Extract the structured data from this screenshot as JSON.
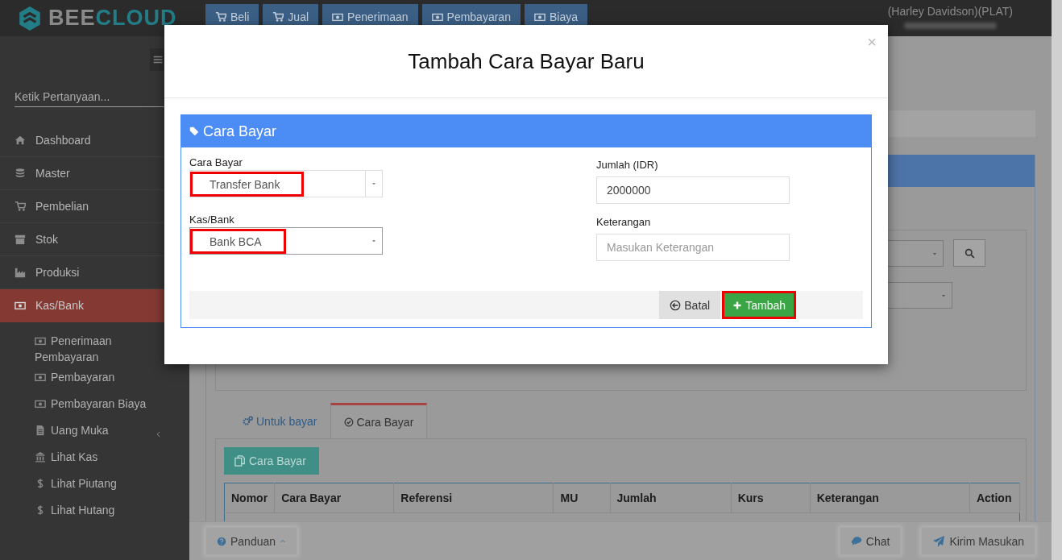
{
  "brand": {
    "part_1": "BEE",
    "part_2": "CLOUD"
  },
  "top_nav": [
    {
      "label": "Beli"
    },
    {
      "label": "Jual"
    },
    {
      "label": "Penerimaan"
    },
    {
      "label": "Pembayaran"
    },
    {
      "label": "Biaya"
    }
  ],
  "user": {
    "name": "(Harley Davidson)(PLAT)"
  },
  "sidebar": {
    "search": {
      "placeholder": "Ketik Pertanyaan..."
    },
    "items": [
      {
        "label": "Dashboard",
        "selected": false
      },
      {
        "label": "Master",
        "selected": false
      },
      {
        "label": "Pembelian",
        "selected": false
      },
      {
        "label": "Stok",
        "selected": false
      },
      {
        "label": "Produksi",
        "selected": false
      },
      {
        "label": "Kas/Bank",
        "selected": true,
        "children": [
          {
            "label": "Penerimaan Pembayaran",
            "has_submenu": false
          },
          {
            "label": "Pembayaran",
            "has_submenu": false
          },
          {
            "label": "Pembayaran Biaya",
            "has_submenu": false
          },
          {
            "label": "Uang Muka",
            "has_submenu": true
          },
          {
            "label": "Lihat Kas",
            "has_submenu": false
          },
          {
            "label": "Lihat Piutang",
            "has_submenu": false
          },
          {
            "label": "Lihat Hutang",
            "has_submenu": false
          }
        ]
      }
    ]
  },
  "main": {
    "tabs": [
      {
        "label": "Untuk bayar",
        "selected": false
      },
      {
        "label": "Cara Bayar",
        "selected": true
      }
    ],
    "add_button": "Cara Bayar",
    "table": {
      "columns": [
        "Nomor",
        "Cara Bayar",
        "Referensi",
        "MU",
        "Jumlah",
        "Kurs",
        "Keterangan",
        "Action"
      ]
    }
  },
  "modal": {
    "title": "Tambah Cara Bayar Baru",
    "close": "×",
    "panel_title": "Cara Bayar",
    "fields": [
      {
        "kind": "select",
        "label": "Cara Bayar",
        "value": "Transfer Bank",
        "highlighted": true
      },
      {
        "kind": "select",
        "label": "Kas/Bank",
        "value": "Bank BCA",
        "highlighted": true
      },
      {
        "kind": "text",
        "label": "Jumlah (IDR)",
        "value": "2000000",
        "highlighted": false
      },
      {
        "kind": "text",
        "label": "Keterangan",
        "placeholder": "Masukan Keterangan",
        "highlighted": false
      }
    ],
    "buttons": [
      {
        "kind": "cancel",
        "label": "Batal",
        "highlighted": false
      },
      {
        "kind": "primary",
        "label": "Tambah",
        "highlighted": true
      }
    ]
  },
  "footer": {
    "buttons": [
      {
        "label": "Panduan"
      },
      {
        "label": "Chat"
      },
      {
        "label": "Kirim Masukan"
      }
    ]
  }
}
